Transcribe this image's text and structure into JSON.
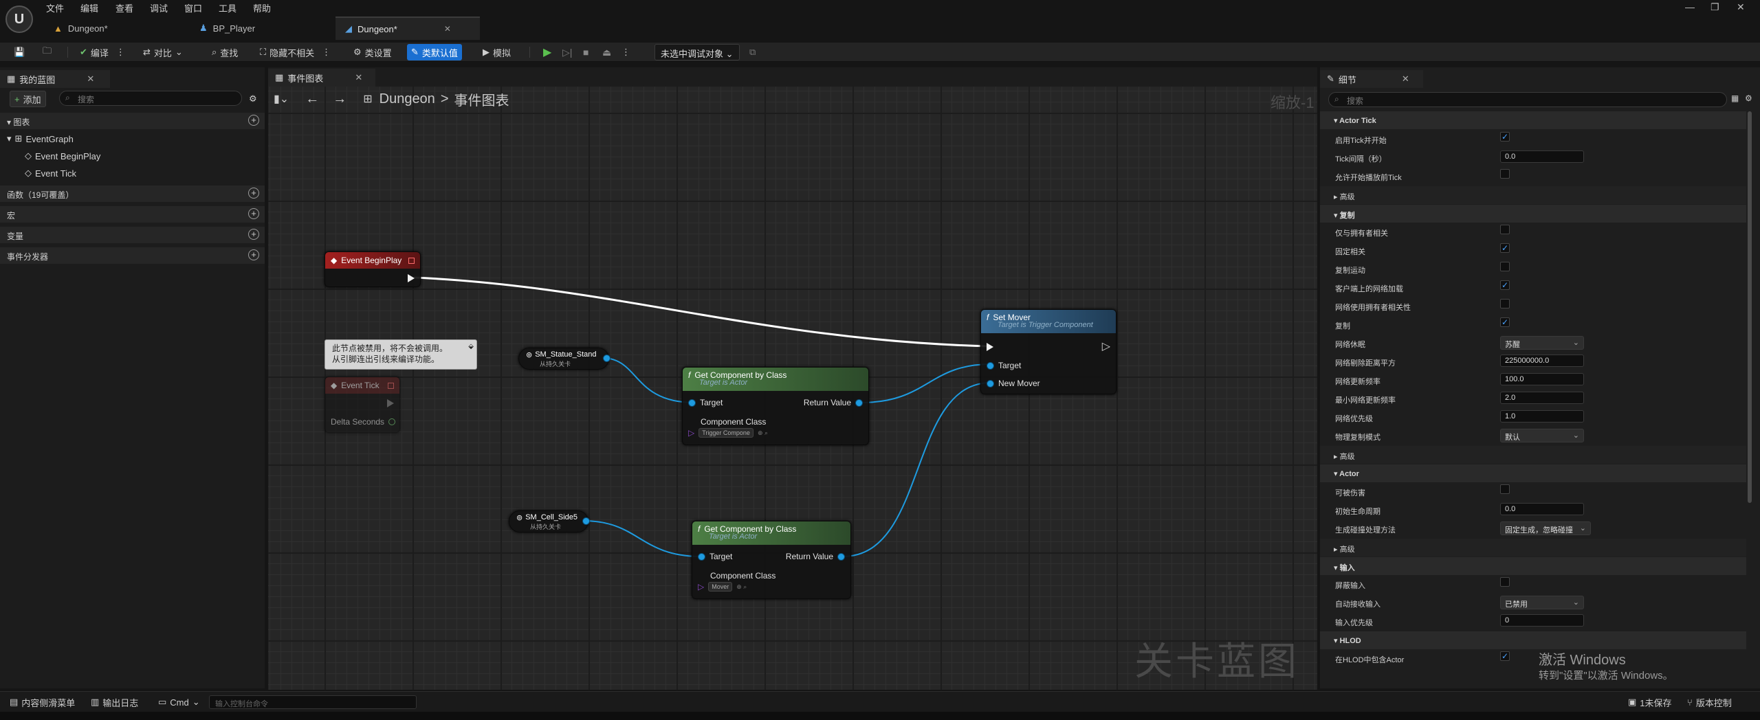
{
  "menu": [
    "文件",
    "编辑",
    "查看",
    "调试",
    "窗口",
    "工具",
    "帮助"
  ],
  "tabs": [
    {
      "label": "Dungeon*",
      "active": false
    },
    {
      "label": "BP_Player",
      "active": false
    },
    {
      "label": "Dungeon*",
      "active": true
    }
  ],
  "toolbar": {
    "compile": "编译",
    "diff": "对比",
    "find": "查找",
    "hide_unrelated": "隐藏不相关",
    "class_settings": "类设置",
    "class_defaults": "类默认值",
    "simulate": "模拟",
    "debug_object": "未选中调试对象"
  },
  "left_panel": {
    "tab_title": "我的蓝图",
    "add_label": "添加",
    "search_placeholder": "搜索",
    "graphs_header": "图表",
    "event_graph": "EventGraph",
    "events": [
      "Event BeginPlay",
      "Event Tick"
    ],
    "functions_header": "函数（19可覆盖）",
    "macros_header": "宏",
    "variables_header": "变量",
    "dispatchers_header": "事件分发器"
  },
  "graph": {
    "tab_title": "事件图表",
    "breadcrumb_root": "Dungeon",
    "breadcrumb_sep": ">",
    "breadcrumb_current": "事件图表",
    "zoom_text": "缩放-1",
    "watermark": "关卡蓝图",
    "nodes": {
      "begin_play": {
        "title": "Event BeginPlay"
      },
      "disabled_comment": {
        "line1": "此节点被禁用，将不会被调用。",
        "line2": "从引脚连出引线来编译功能。"
      },
      "event_tick": {
        "title": "Event Tick",
        "pin": "Delta Seconds"
      },
      "statue": {
        "title": "SM_Statue_Stand",
        "sub": "从持久关卡"
      },
      "cell": {
        "title": "SM_Cell_Side5",
        "sub": "从持久关卡"
      },
      "get_comp_1": {
        "title": "Get Component by Class",
        "sub": "Target is Actor",
        "target": "Target",
        "return": "Return Value",
        "class_label": "Component Class",
        "class_value": "Trigger Compone"
      },
      "get_comp_2": {
        "title": "Get Component by Class",
        "sub": "Target is Actor",
        "target": "Target",
        "return": "Return Value",
        "class_label": "Component Class",
        "class_value": "Mover"
      },
      "set_mover": {
        "title": "Set Mover",
        "sub": "Target is Trigger Component",
        "target": "Target",
        "new_mover": "New Mover"
      }
    }
  },
  "details": {
    "tab_title": "细节",
    "search_placeholder": "搜索",
    "sections": {
      "actor_tick": "Actor Tick",
      "advanced1": "高级",
      "replication": "复制",
      "advanced2": "高级",
      "actor": "Actor",
      "advanced3": "高级",
      "input": "输入",
      "hlod": "HLOD"
    },
    "rows": {
      "start_with_tick": {
        "label": "启用Tick并开始",
        "checked": true
      },
      "tick_interval": {
        "label": "Tick间隔（秒）",
        "value": "0.0"
      },
      "tick_before_begin": {
        "label": "允许开始播放前Tick",
        "checked": false
      },
      "only_relevant_owner": {
        "label": "仅与拥有者相关",
        "checked": false
      },
      "always_relevant": {
        "label": "固定相关",
        "checked": true
      },
      "replicate_movement": {
        "label": "复制运动",
        "checked": false
      },
      "net_load_client": {
        "label": "客户端上的网络加载",
        "checked": true
      },
      "net_use_owner_relevancy": {
        "label": "网络使用拥有者相关性",
        "checked": false
      },
      "replicates": {
        "label": "复制",
        "checked": true
      },
      "net_dormancy": {
        "label": "网络休眠",
        "value": "苏醒"
      },
      "net_cull_distance": {
        "label": "网络剔除距离平方",
        "value": "225000000.0"
      },
      "net_update_freq": {
        "label": "网络更新频率",
        "value": "100.0"
      },
      "min_net_update_freq": {
        "label": "最小网络更新频率",
        "value": "2.0"
      },
      "net_priority": {
        "label": "网络优先级",
        "value": "1.0"
      },
      "physics_rep_mode": {
        "label": "物理复制模式",
        "value": "默认"
      },
      "can_be_damaged": {
        "label": "可被伤害",
        "checked": false
      },
      "initial_life_span": {
        "label": "初始生命周期",
        "value": "0.0"
      },
      "spawn_collision": {
        "label": "生成碰撞处理方法",
        "value": "固定生成，忽略碰撞"
      },
      "block_input": {
        "label": "屏蔽输入",
        "checked": false
      },
      "auto_receive_input": {
        "label": "自动接收输入",
        "value": "已禁用"
      },
      "input_priority": {
        "label": "输入优先级",
        "value": "0"
      },
      "include_in_hlod": {
        "label": "在HLOD中包含Actor",
        "checked": true
      }
    }
  },
  "statusbar": {
    "content_drawer": "内容侧滑菜单",
    "output_log": "输出日志",
    "cmd": "Cmd",
    "console_placeholder": "输入控制台命令",
    "unsaved": "1未保存",
    "source_control": "版本控制"
  },
  "activation": {
    "title": "激活 Windows",
    "subtitle": "转到\"设置\"以激活 Windows。"
  },
  "colors": {
    "accent": "#1a6fd1",
    "event_node_head": "#8b1a1a",
    "pure_node_head": "#3e6b3a",
    "function_node_head": "#2b4f73",
    "object_pin": "#1e9be0"
  }
}
